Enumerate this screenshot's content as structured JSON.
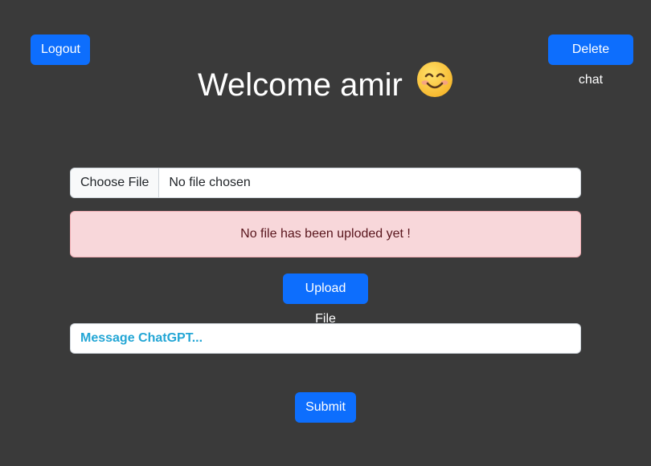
{
  "header": {
    "logout_label": "Logout",
    "delete_chat_label": "Delete chat",
    "welcome_text": "Welcome amir",
    "emoji": "😊"
  },
  "upload": {
    "choose_file_label": "Choose File",
    "file_status": "No file chosen",
    "alert_text": "No file has been uploded yet !",
    "upload_button_label": "Upload File"
  },
  "chat": {
    "message_placeholder": "Message ChatGPT...",
    "submit_label": "Submit"
  },
  "colors": {
    "background": "#3a3a3a",
    "primary": "#0d6efd",
    "alert_bg": "#f8d7da",
    "placeholder": "#23a6d5"
  }
}
